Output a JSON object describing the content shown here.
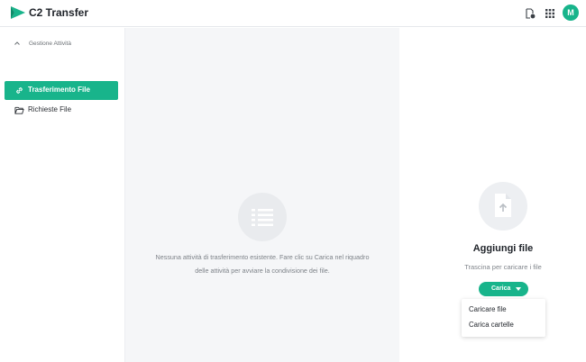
{
  "header": {
    "app_title": "C2 Transfer",
    "avatar_initial": "M",
    "icons": [
      "logo-icon",
      "file-info-icon",
      "apps-grid-icon"
    ]
  },
  "sidebar": {
    "section_label": "Gestione Attività",
    "items": [
      {
        "label": "Trasferimento File",
        "icon": "link-icon",
        "active": true
      },
      {
        "label": "Richieste File",
        "icon": "folder-open-icon",
        "active": false
      }
    ]
  },
  "main": {
    "empty_message": "Nessuna attività di trasferimento esistente. Fare clic su Carica nel riquadro delle attività per avviare la condivisione dei file."
  },
  "upload_panel": {
    "title": "Aggiungi file",
    "hint": "Trascina per caricare i file",
    "button_label": "Carica",
    "menu": [
      "Caricare file",
      "Carica cartelle"
    ]
  },
  "colors": {
    "accent": "#18b48b",
    "main_background": "#f5f6f8"
  }
}
